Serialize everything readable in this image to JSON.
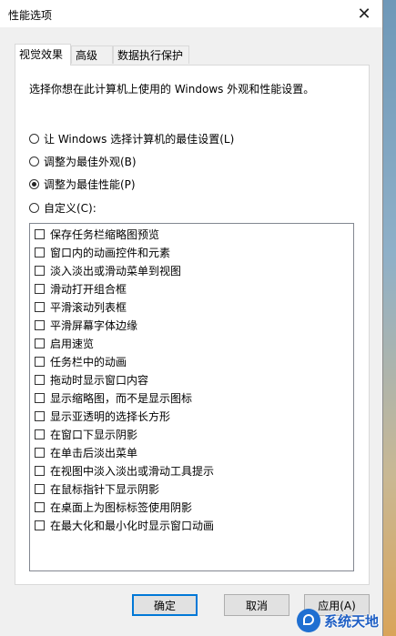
{
  "window": {
    "title": "性能选项",
    "close_icon": "close-icon"
  },
  "tabs": [
    {
      "label": "视觉效果",
      "active": true
    },
    {
      "label": "高级",
      "active": false
    },
    {
      "label": "数据执行保护",
      "active": false
    }
  ],
  "panel": {
    "description": "选择你想在此计算机上使用的 Windows 外观和性能设置。",
    "radios": [
      {
        "label": "让 Windows 选择计算机的最佳设置(L)",
        "selected": false
      },
      {
        "label": "调整为最佳外观(B)",
        "selected": false
      },
      {
        "label": "调整为最佳性能(P)",
        "selected": true
      },
      {
        "label": "自定义(C):",
        "selected": false
      }
    ],
    "options": [
      {
        "label": "保存任务栏缩略图预览",
        "checked": false
      },
      {
        "label": "窗口内的动画控件和元素",
        "checked": false
      },
      {
        "label": "淡入淡出或滑动菜单到视图",
        "checked": false
      },
      {
        "label": "滑动打开组合框",
        "checked": false
      },
      {
        "label": "平滑滚动列表框",
        "checked": false
      },
      {
        "label": "平滑屏幕字体边缘",
        "checked": false
      },
      {
        "label": "启用速览",
        "checked": false
      },
      {
        "label": "任务栏中的动画",
        "checked": false
      },
      {
        "label": "拖动时显示窗口内容",
        "checked": false
      },
      {
        "label": "显示缩略图，而不是显示图标",
        "checked": false
      },
      {
        "label": "显示亚透明的选择长方形",
        "checked": false
      },
      {
        "label": "在窗口下显示阴影",
        "checked": false
      },
      {
        "label": "在单击后淡出菜单",
        "checked": false
      },
      {
        "label": "在视图中淡入淡出或滑动工具提示",
        "checked": false
      },
      {
        "label": "在鼠标指针下显示阴影",
        "checked": false
      },
      {
        "label": "在桌面上为图标标签使用阴影",
        "checked": false
      },
      {
        "label": "在最大化和最小化时显示窗口动画",
        "checked": false
      }
    ]
  },
  "buttons": {
    "ok": "确定",
    "cancel": "取消",
    "apply": "应用(A)"
  },
  "watermark": {
    "text": "系统天地"
  }
}
